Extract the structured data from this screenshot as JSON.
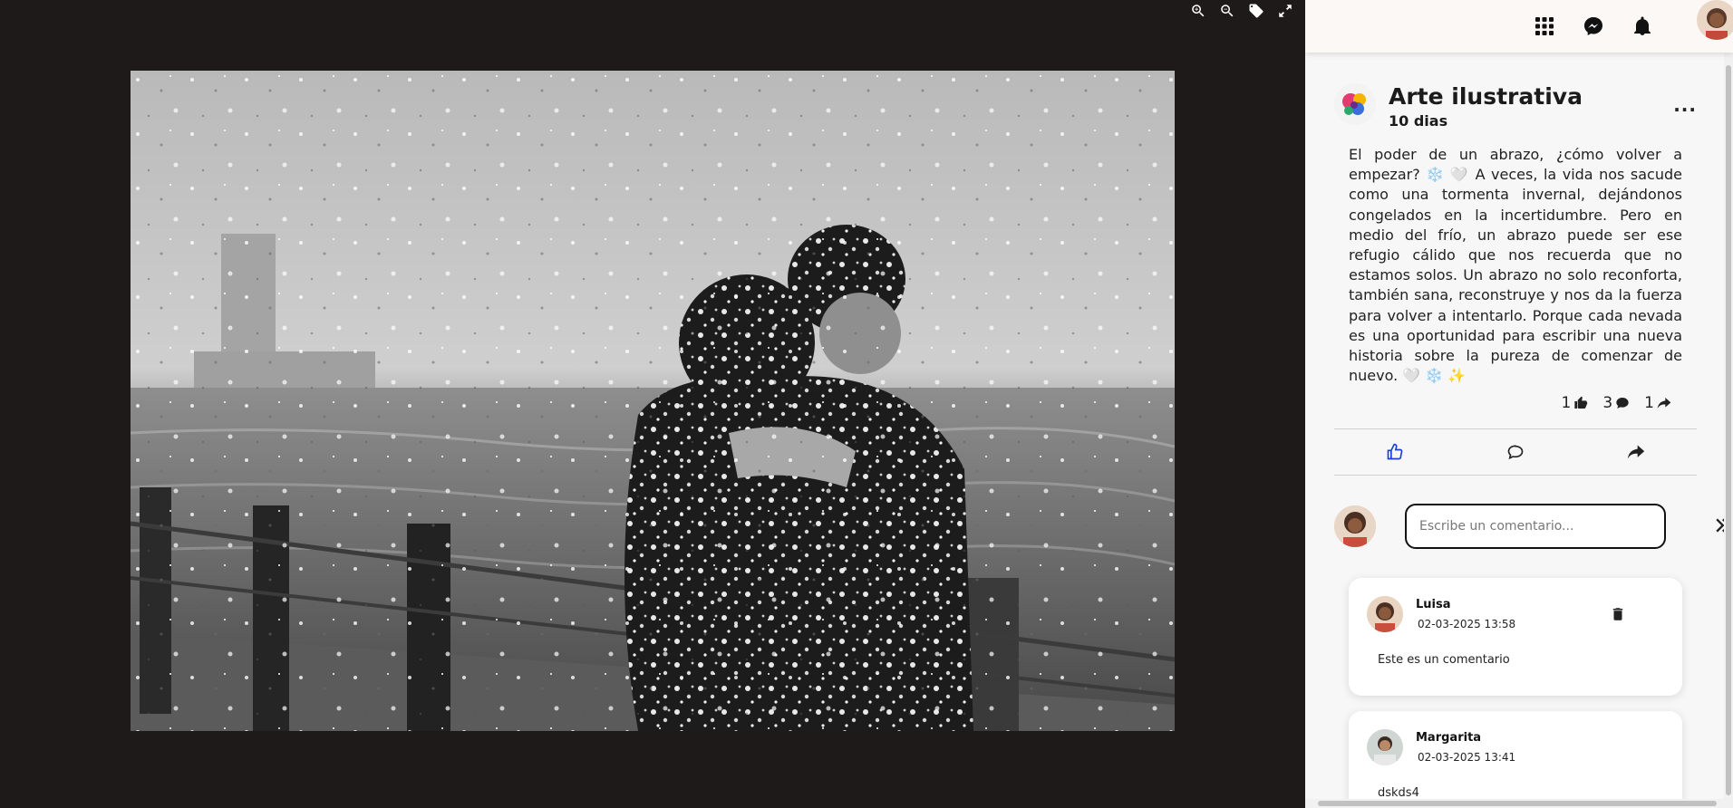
{
  "viewer": {
    "toolbar": {
      "zoom_in_icon": "zoom-in-icon",
      "zoom_out_icon": "zoom-out-icon",
      "tag_icon": "tag-icon",
      "fullscreen_icon": "fullscreen-icon"
    },
    "photo_alt": "Pareja abrazándose bajo una nevada frente al mar"
  },
  "topbar": {
    "apps_icon": "apps-grid-icon",
    "messenger_icon": "messenger-icon",
    "notifications_icon": "bell-icon"
  },
  "post": {
    "page_name": "Arte ilustrativa",
    "time": "10 dias",
    "more": "...",
    "text": "El poder de un abrazo, ¿cómo volver a empezar? ❄️ 🤍  A veces, la vida nos sacude como una tormenta invernal, dejándonos congelados en la incertidumbre. Pero en medio del frío, un abrazo puede ser ese refugio cálido que nos recuerda que no estamos solos. Un abrazo no solo reconforta, también sana, reconstruye y nos da la fuerza para volver a intentarlo. Porque cada nevada es una oportunidad para escribir una nueva historia sobre la pureza de comenzar de nuevo. 🤍 ❄️ ✨",
    "counts": {
      "likes": "1",
      "comments": "3",
      "shares": "1"
    },
    "accent_color": "#1a3fd6"
  },
  "comment_box": {
    "placeholder": "Escribe un comentario...",
    "value": ""
  },
  "comments": [
    {
      "author": "Luisa",
      "date": "02-03-2025 13:58",
      "text": "Este es un comentario"
    },
    {
      "author": "Margarita",
      "date": "02-03-2025 13:41",
      "text": "dskds4"
    }
  ]
}
